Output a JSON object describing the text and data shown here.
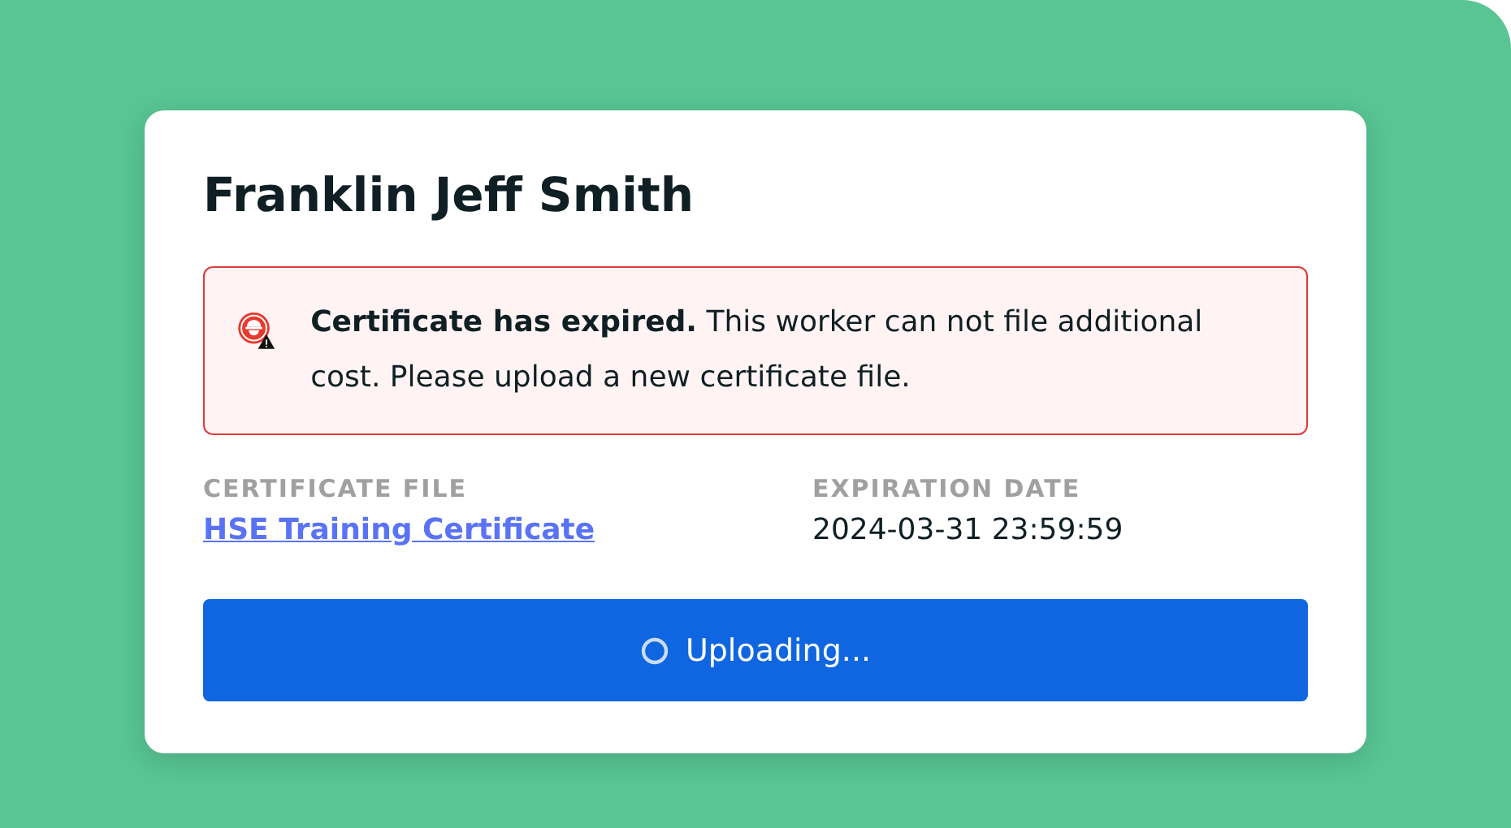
{
  "card": {
    "title": "Franklin Jeff Smith",
    "alert": {
      "kind": "error",
      "message": "**Certificate has expired.** This worker can not file additional cost. Please upload a new certificate file."
    },
    "fields": [
      {
        "label": "CERTIFICATE FILE",
        "value": "HSE Training Certificate",
        "kind": "link"
      },
      {
        "label": "EXPIRATION DATE",
        "value": "2024-03-31 23:59:59",
        "kind": "text"
      }
    ],
    "button": {
      "label": "Uploading...",
      "loading": true
    }
  }
}
